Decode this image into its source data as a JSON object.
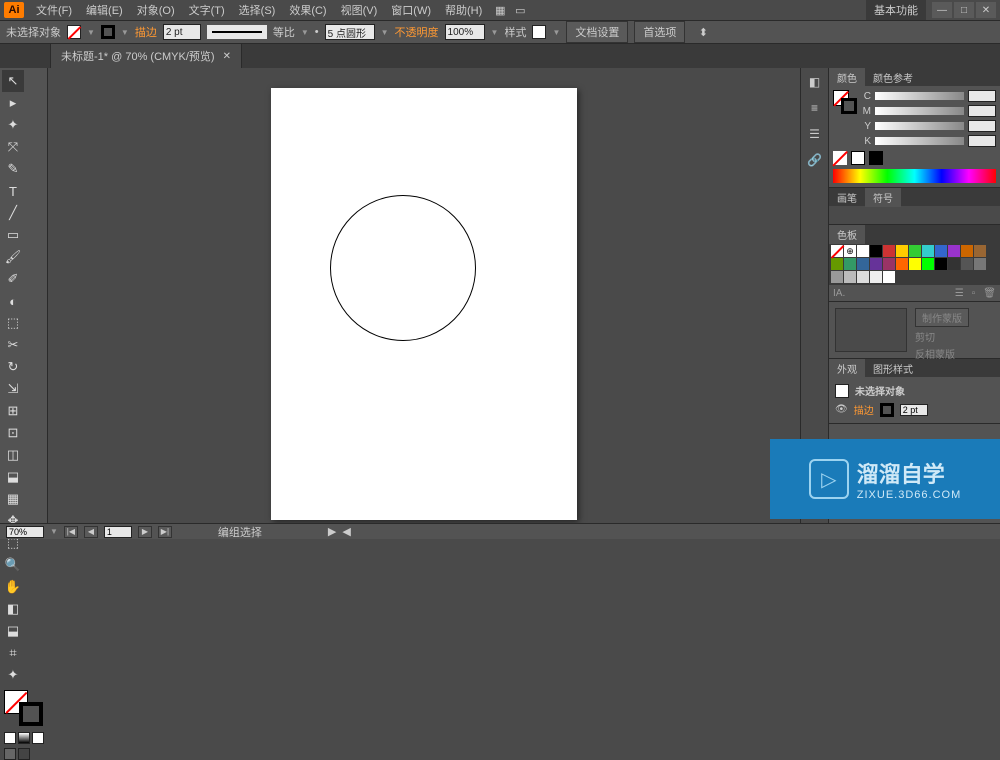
{
  "app": {
    "logo": "Ai"
  },
  "menu": [
    "文件(F)",
    "编辑(E)",
    "对象(O)",
    "文字(T)",
    "选择(S)",
    "效果(C)",
    "视图(V)",
    "窗口(W)",
    "帮助(H)"
  ],
  "workspace_label": "基本功能",
  "options": {
    "selection_status": "未选择对象",
    "stroke_label": "描边",
    "stroke_weight": "2 pt",
    "dash_label": "等比",
    "profile_value": "5 点圆形",
    "opacity_label": "不透明度",
    "opacity_value": "100%",
    "style_label": "样式",
    "doc_setup": "文档设置",
    "preferences": "首选项"
  },
  "tab": {
    "title": "未标题-1* @ 70% (CMYK/预览)"
  },
  "tools": [
    "↖",
    "▸",
    "✦",
    "⤧",
    "✎",
    "T",
    "╱",
    "▭",
    "🖌",
    "✐",
    "◐",
    "⬚",
    "✂",
    "↻",
    "⇲",
    "⊞",
    "⊡",
    "◫",
    "⬓",
    "▦",
    "✥",
    "⬚",
    "🔍",
    "✋",
    "◧",
    "⬓",
    "⌗",
    "✦"
  ],
  "right": {
    "color": {
      "tab1": "颜色",
      "tab2": "颜色参考",
      "labels": [
        "C",
        "M",
        "Y",
        "K"
      ]
    },
    "brushes": {
      "tab1": "画笔",
      "tab2": "符号"
    },
    "swatches": {
      "tab": "色板",
      "row1": [
        "#ffffff",
        "#000000",
        "#e6e6e6",
        "#ff0000",
        "#ffff00",
        "#00ff00",
        "#00ffff",
        "#0000ff",
        "#ff00ff",
        "#8b0000"
      ],
      "row2": [
        "#cc6600",
        "#996633",
        "#669900",
        "#339966",
        "#336699",
        "#663399",
        "#993366",
        "#666666",
        "#999999",
        "#cccccc"
      ],
      "row3": [
        "#808080",
        "#a0a0a0",
        "#b0b0b0",
        "#c0c0c0",
        "#d0d0d0",
        "#e0e0e0",
        "#f0f0f0",
        "#ffffff",
        "#ffffff",
        "#ffffff"
      ]
    },
    "mask": {
      "make": "制作蒙版",
      "clip": "剪切",
      "invert": "反相蒙版"
    },
    "appearance": {
      "tab1": "外观",
      "tab2": "图形样式",
      "no_sel": "未选择对象",
      "stroke": "描边",
      "stroke_w": "2 pt"
    }
  },
  "status": {
    "zoom": "70%",
    "page": "1",
    "mode": "编组选择"
  },
  "watermark": {
    "main": "溜溜自学",
    "sub": "ZIXUE.3D66.COM"
  }
}
